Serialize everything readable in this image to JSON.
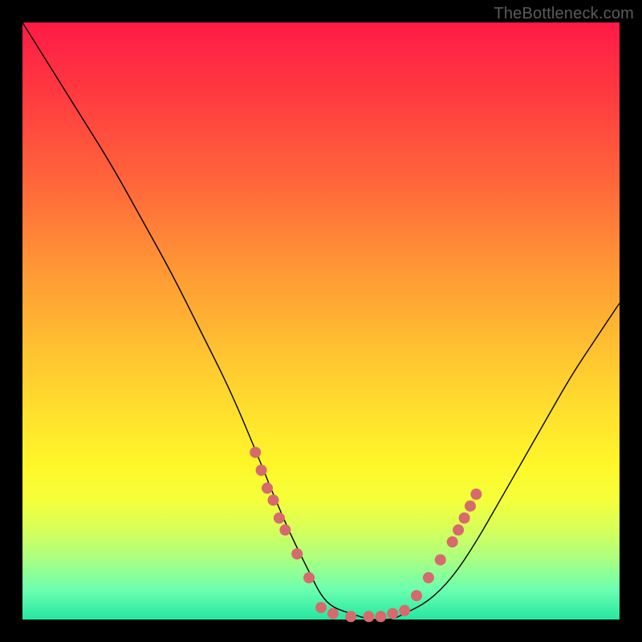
{
  "watermark": "TheBottleneck.com",
  "colors": {
    "background": "#000000",
    "curve": "#000000",
    "dots": "#d66a6d",
    "gradient_top": "#ff1a47",
    "gradient_bottom": "#25e6a0"
  },
  "chart_data": {
    "type": "line",
    "title": "",
    "xlabel": "",
    "ylabel": "",
    "xlim": [
      0,
      100
    ],
    "ylim": [
      0,
      100
    ],
    "annotations": [
      "TheBottleneck.com"
    ],
    "series": [
      {
        "name": "bottleneck-curve",
        "x": [
          0,
          5,
          10,
          15,
          20,
          25,
          30,
          35,
          40,
          42,
          45,
          48,
          50,
          52,
          55,
          58,
          60,
          62,
          64,
          68,
          72,
          76,
          80,
          84,
          88,
          92,
          96,
          100
        ],
        "y": [
          100,
          92,
          84,
          76,
          67,
          58,
          48,
          38,
          26,
          21,
          14,
          8,
          4,
          2,
          1,
          0,
          0,
          0,
          1,
          3,
          7,
          13,
          20,
          27,
          34,
          41,
          47,
          53
        ]
      }
    ],
    "marker_clusters": [
      {
        "name": "left-steep-dots",
        "x": [
          39,
          40,
          41,
          42,
          43,
          44,
          46,
          48
        ],
        "y": [
          28,
          25,
          22,
          20,
          17,
          15,
          11,
          7
        ]
      },
      {
        "name": "valley-dots",
        "x": [
          50,
          52,
          55,
          58,
          60,
          62,
          64
        ],
        "y": [
          2,
          1,
          0.5,
          0.5,
          0.5,
          1,
          1.5
        ]
      },
      {
        "name": "right-upslope-dots",
        "x": [
          66,
          68,
          70,
          72,
          73,
          74,
          75,
          76
        ],
        "y": [
          4,
          7,
          10,
          13,
          15,
          17,
          19,
          21
        ]
      }
    ]
  }
}
